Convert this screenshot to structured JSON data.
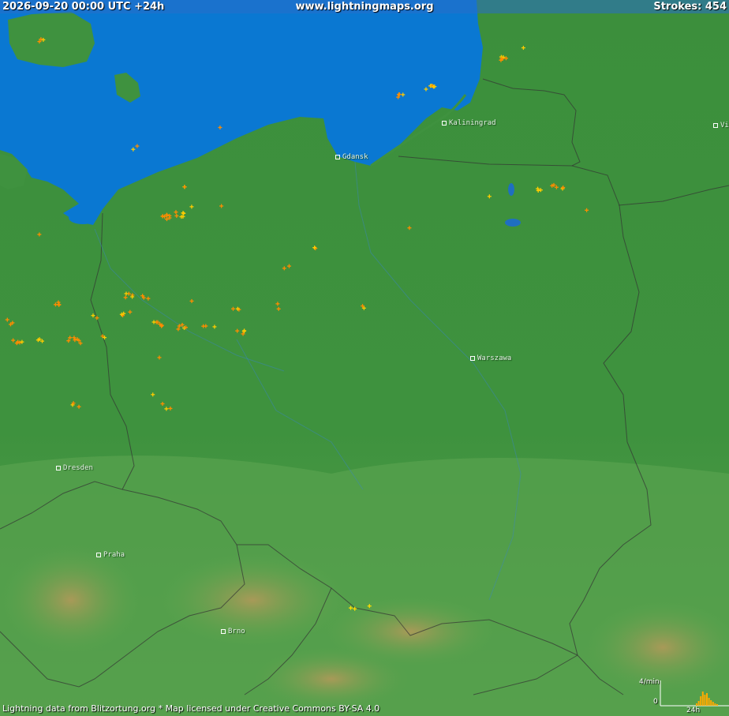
{
  "header": {
    "timestamp": "2026-09-20 00:00 UTC +24h",
    "site": "www.lightningmaps.org",
    "strokes_label": "Strokes: 454"
  },
  "cities": [
    {
      "name": "Gdansk"
    },
    {
      "name": "Kaliningrad"
    },
    {
      "name": "Warszawa"
    },
    {
      "name": "Dresden"
    },
    {
      "name": "Praha"
    },
    {
      "name": "Brno"
    },
    {
      "name": "Vi"
    }
  ],
  "footer": {
    "attribution": "Lightning data from Blitzortung.org  *  Map licensed under Creative Commons BY-SA 4.0"
  },
  "histogram": {
    "ymax_label": "4/min",
    "ymin_label": "0",
    "xlabel": "24h"
  },
  "colors": {
    "sea": "#0a78d2",
    "land": "#3f923f",
    "highland": "#5aa54e",
    "mountain": "#9a9a55",
    "strike_recent": "#ffdd00",
    "strike_old": "#ff8c00",
    "border": "#333333"
  }
}
